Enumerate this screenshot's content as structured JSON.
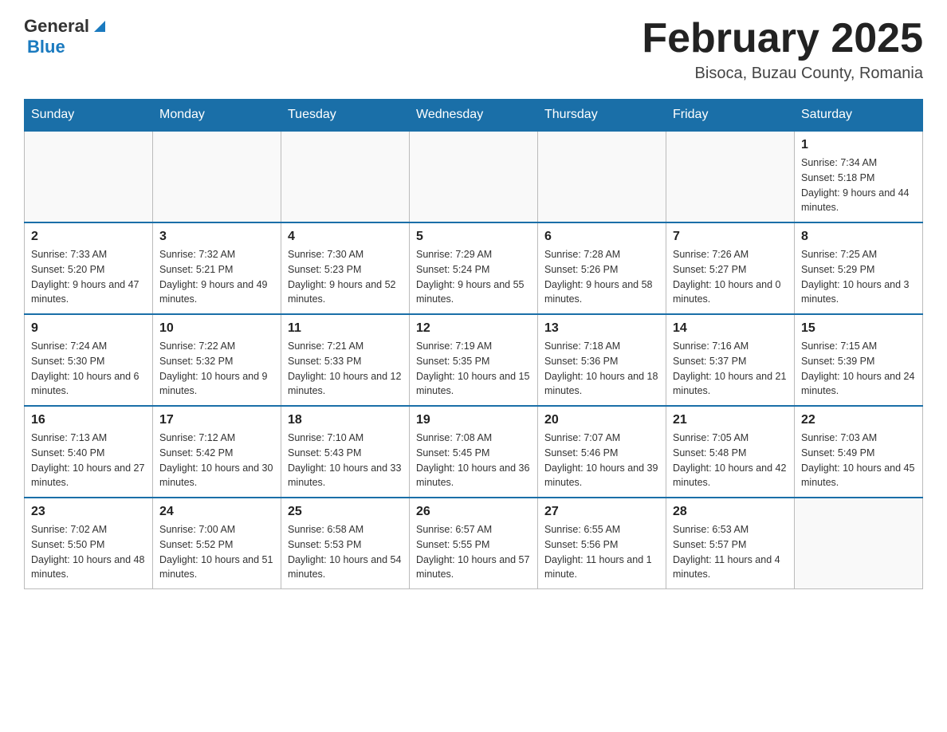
{
  "header": {
    "logo_general": "General",
    "logo_blue": "Blue",
    "month_title": "February 2025",
    "location": "Bisoca, Buzau County, Romania"
  },
  "days_of_week": [
    "Sunday",
    "Monday",
    "Tuesday",
    "Wednesday",
    "Thursday",
    "Friday",
    "Saturday"
  ],
  "weeks": [
    {
      "days": [
        {
          "number": "",
          "info": ""
        },
        {
          "number": "",
          "info": ""
        },
        {
          "number": "",
          "info": ""
        },
        {
          "number": "",
          "info": ""
        },
        {
          "number": "",
          "info": ""
        },
        {
          "number": "",
          "info": ""
        },
        {
          "number": "1",
          "info": "Sunrise: 7:34 AM\nSunset: 5:18 PM\nDaylight: 9 hours and 44 minutes."
        }
      ]
    },
    {
      "days": [
        {
          "number": "2",
          "info": "Sunrise: 7:33 AM\nSunset: 5:20 PM\nDaylight: 9 hours and 47 minutes."
        },
        {
          "number": "3",
          "info": "Sunrise: 7:32 AM\nSunset: 5:21 PM\nDaylight: 9 hours and 49 minutes."
        },
        {
          "number": "4",
          "info": "Sunrise: 7:30 AM\nSunset: 5:23 PM\nDaylight: 9 hours and 52 minutes."
        },
        {
          "number": "5",
          "info": "Sunrise: 7:29 AM\nSunset: 5:24 PM\nDaylight: 9 hours and 55 minutes."
        },
        {
          "number": "6",
          "info": "Sunrise: 7:28 AM\nSunset: 5:26 PM\nDaylight: 9 hours and 58 minutes."
        },
        {
          "number": "7",
          "info": "Sunrise: 7:26 AM\nSunset: 5:27 PM\nDaylight: 10 hours and 0 minutes."
        },
        {
          "number": "8",
          "info": "Sunrise: 7:25 AM\nSunset: 5:29 PM\nDaylight: 10 hours and 3 minutes."
        }
      ]
    },
    {
      "days": [
        {
          "number": "9",
          "info": "Sunrise: 7:24 AM\nSunset: 5:30 PM\nDaylight: 10 hours and 6 minutes."
        },
        {
          "number": "10",
          "info": "Sunrise: 7:22 AM\nSunset: 5:32 PM\nDaylight: 10 hours and 9 minutes."
        },
        {
          "number": "11",
          "info": "Sunrise: 7:21 AM\nSunset: 5:33 PM\nDaylight: 10 hours and 12 minutes."
        },
        {
          "number": "12",
          "info": "Sunrise: 7:19 AM\nSunset: 5:35 PM\nDaylight: 10 hours and 15 minutes."
        },
        {
          "number": "13",
          "info": "Sunrise: 7:18 AM\nSunset: 5:36 PM\nDaylight: 10 hours and 18 minutes."
        },
        {
          "number": "14",
          "info": "Sunrise: 7:16 AM\nSunset: 5:37 PM\nDaylight: 10 hours and 21 minutes."
        },
        {
          "number": "15",
          "info": "Sunrise: 7:15 AM\nSunset: 5:39 PM\nDaylight: 10 hours and 24 minutes."
        }
      ]
    },
    {
      "days": [
        {
          "number": "16",
          "info": "Sunrise: 7:13 AM\nSunset: 5:40 PM\nDaylight: 10 hours and 27 minutes."
        },
        {
          "number": "17",
          "info": "Sunrise: 7:12 AM\nSunset: 5:42 PM\nDaylight: 10 hours and 30 minutes."
        },
        {
          "number": "18",
          "info": "Sunrise: 7:10 AM\nSunset: 5:43 PM\nDaylight: 10 hours and 33 minutes."
        },
        {
          "number": "19",
          "info": "Sunrise: 7:08 AM\nSunset: 5:45 PM\nDaylight: 10 hours and 36 minutes."
        },
        {
          "number": "20",
          "info": "Sunrise: 7:07 AM\nSunset: 5:46 PM\nDaylight: 10 hours and 39 minutes."
        },
        {
          "number": "21",
          "info": "Sunrise: 7:05 AM\nSunset: 5:48 PM\nDaylight: 10 hours and 42 minutes."
        },
        {
          "number": "22",
          "info": "Sunrise: 7:03 AM\nSunset: 5:49 PM\nDaylight: 10 hours and 45 minutes."
        }
      ]
    },
    {
      "days": [
        {
          "number": "23",
          "info": "Sunrise: 7:02 AM\nSunset: 5:50 PM\nDaylight: 10 hours and 48 minutes."
        },
        {
          "number": "24",
          "info": "Sunrise: 7:00 AM\nSunset: 5:52 PM\nDaylight: 10 hours and 51 minutes."
        },
        {
          "number": "25",
          "info": "Sunrise: 6:58 AM\nSunset: 5:53 PM\nDaylight: 10 hours and 54 minutes."
        },
        {
          "number": "26",
          "info": "Sunrise: 6:57 AM\nSunset: 5:55 PM\nDaylight: 10 hours and 57 minutes."
        },
        {
          "number": "27",
          "info": "Sunrise: 6:55 AM\nSunset: 5:56 PM\nDaylight: 11 hours and 1 minute."
        },
        {
          "number": "28",
          "info": "Sunrise: 6:53 AM\nSunset: 5:57 PM\nDaylight: 11 hours and 4 minutes."
        },
        {
          "number": "",
          "info": ""
        }
      ]
    }
  ]
}
